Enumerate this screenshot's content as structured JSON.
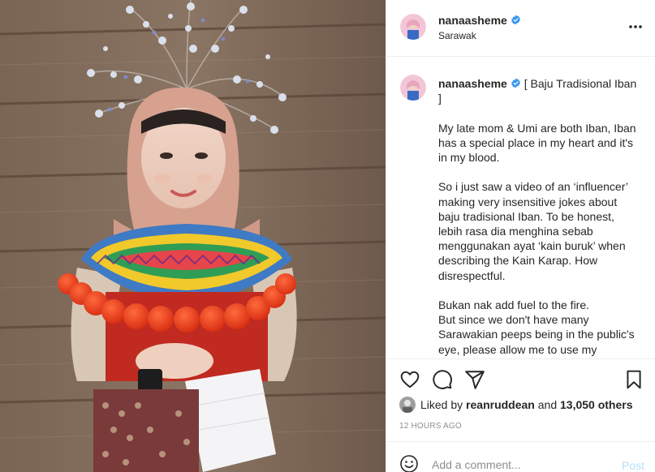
{
  "header": {
    "username": "nanaasheme",
    "location": "Sarawak",
    "verified_icon": "verified-badge-icon",
    "more_icon": "more-options-icon"
  },
  "caption": {
    "username": "nanaasheme",
    "text": "[ Baju Tradisional Iban ]\n\nMy late mom & Umi are both Iban, Iban has a special place in my heart and it's in my blood.\n\nSo i just saw a video of an ‘influencer’ making very insensitive jokes about baju tradisional Iban. To be honest, lebih rasa dia menghina sebab menggunakan ayat ‘kain buruk’ when describing the Kain Karap. How disrespectful.\n\nBukan nak add fuel to the fire.\nBut since we don't have many Sarawakian peeps being in the public's eye, please allow me to use my"
  },
  "actions": {
    "icons": [
      "heart-icon",
      "comment-icon",
      "share-icon",
      "bookmark-icon"
    ]
  },
  "likes": {
    "prefix": "Liked by",
    "user": "reanruddean",
    "joiner": "and",
    "others": "13,050 others"
  },
  "timestamp": "12 HOURS AGO",
  "comment": {
    "placeholder": "Add a comment...",
    "post_label": "Post"
  },
  "colors": {
    "verified": "#3897f0",
    "post_disabled": "#b2dffc",
    "muted": "#8e8e8e",
    "border": "#efefef"
  }
}
